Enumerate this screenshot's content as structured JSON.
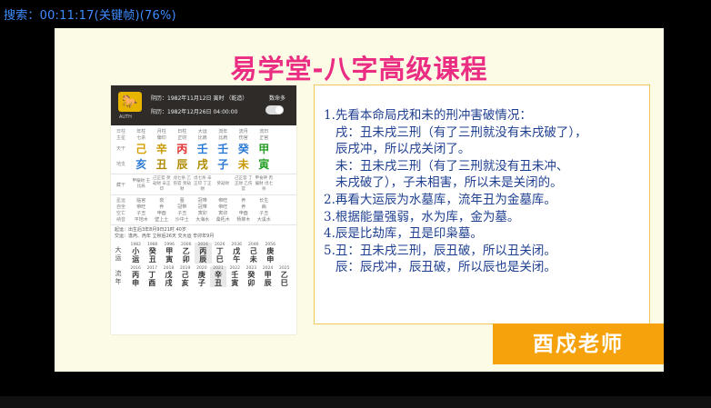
{
  "search_status": "搜索：00:11:17(关键帧)(76%)",
  "slide": {
    "title": "易学堂-八字高级课程",
    "phone": {
      "auth": "AUTH",
      "date1": "阴历：1982年11月12日 寅时 （乾造）",
      "date2": "阳历：1982年12月26日 04:00:00",
      "gender": "数命多",
      "row_labels": [
        "日柱",
        "主星",
        "天干",
        "地支",
        "藏干",
        "星运",
        "自坐",
        "空亡",
        "纳音"
      ],
      "headers": [
        "年柱",
        "月柱",
        "日柱",
        "大运",
        "流年",
        "流月",
        "流日",
        "时柱"
      ],
      "zhu_xing": [
        "七杀",
        "偏印",
        "正财",
        "比肩",
        "比肩",
        "伤官",
        "正官",
        "正官"
      ],
      "tian_gan": [
        "己",
        "辛",
        "丙",
        "壬",
        "壬",
        "癸",
        "甲"
      ],
      "tian_gan_colors": [
        "#d8a000",
        "#c99800",
        "#e03030",
        "#2b7bd6",
        "#2b7bd6",
        "#2b7bd6",
        "#2aa02a"
      ],
      "di_zhi": [
        "亥",
        "丑",
        "辰",
        "戌",
        "子",
        "未",
        "寅"
      ],
      "di_zhi_colors": [
        "#2b7bd6",
        "#b08a00",
        "#b08a00",
        "#b08a00",
        "#2b7bd6",
        "#c99800",
        "#2aa02a"
      ],
      "cang_gan": [
        "甲偏财 壬比肩",
        "己正官 癸劫财 辛正印",
        "戊七杀 乙伤官 癸劫财",
        "戊七杀 辛正印 丁正财",
        "癸劫财",
        "己正官 丁正财 乙伤官",
        "甲食神 丙偏财 戊七杀"
      ],
      "xing_yun": [
        "临官",
        "衰",
        "墓",
        "冠带",
        "帝旺",
        "养",
        "长生"
      ],
      "zi_zuo": [
        "帝旺",
        "养",
        "冠带",
        "冠带",
        "帝旺",
        "养",
        "病"
      ],
      "kong_wang": [
        "子丑",
        "申酉",
        "子丑",
        "寅卯",
        "寅卯",
        "申酉",
        "子丑"
      ],
      "na_yin": [
        "平地木",
        "壁上土",
        "沙中土",
        "大海水",
        "桑柘木",
        "杨柳木",
        "大溪水"
      ],
      "qi_yun": "起运：出生后3年8月9日21时",
      "jiao_yun": "交运：逢丙、丙年 立秋后26天 交大运",
      "age_note": "40岁",
      "year_note": "辛卯年9月",
      "da_yun_label": "大运",
      "liu_nian_label": "流年",
      "da_yun": [
        {
          "yr": "1982",
          "gz": "小运"
        },
        {
          "yr": "1986",
          "gz": "癸丑"
        },
        {
          "yr": "1996",
          "gz": "甲寅"
        },
        {
          "yr": "2006",
          "gz": "乙卯"
        },
        {
          "yr": "2016",
          "gz": "丙辰"
        },
        {
          "yr": "2026",
          "gz": "丁巳"
        },
        {
          "yr": "2036",
          "gz": "戊午"
        },
        {
          "yr": "2046",
          "gz": "己未"
        },
        {
          "yr": "2056",
          "gz": "庚申"
        }
      ],
      "liu_nian": [
        {
          "yr": "2016",
          "gz": "丙申"
        },
        {
          "yr": "2017",
          "gz": "丁酉"
        },
        {
          "yr": "2018",
          "gz": "戊戌"
        },
        {
          "yr": "2019",
          "gz": "己亥"
        },
        {
          "yr": "2020",
          "gz": "庚子"
        },
        {
          "yr": "2021",
          "gz": "辛丑"
        },
        {
          "yr": "2022",
          "gz": "壬寅"
        },
        {
          "yr": "2023",
          "gz": "癸卯"
        },
        {
          "yr": "2024",
          "gz": "甲辰"
        },
        {
          "yr": "2025",
          "gz": "乙巳"
        }
      ]
    },
    "lines": [
      "1.先看本命局戌和未的刑冲害破情况：",
      "   戌：丑未戌三刑（有了三刑就没有未戌破了），",
      "   辰戌冲，所以戌关闭了。",
      "   未：丑未戌三刑（有了三刑就没有丑未冲、",
      "   未戌破了），子未相害，所以未是关闭的。",
      "2.再看大运辰为水墓库，流年丑为金墓库。",
      "3.根据能量强弱，水为库，金为墓。",
      "4.辰是比劫库，丑是印枭墓。",
      "5.丑：丑未戌三刑，辰丑破，所以丑关闭。",
      "   辰：辰戌冲，辰丑破，所以辰也是关闭。"
    ],
    "badge": "酉戍老师"
  }
}
